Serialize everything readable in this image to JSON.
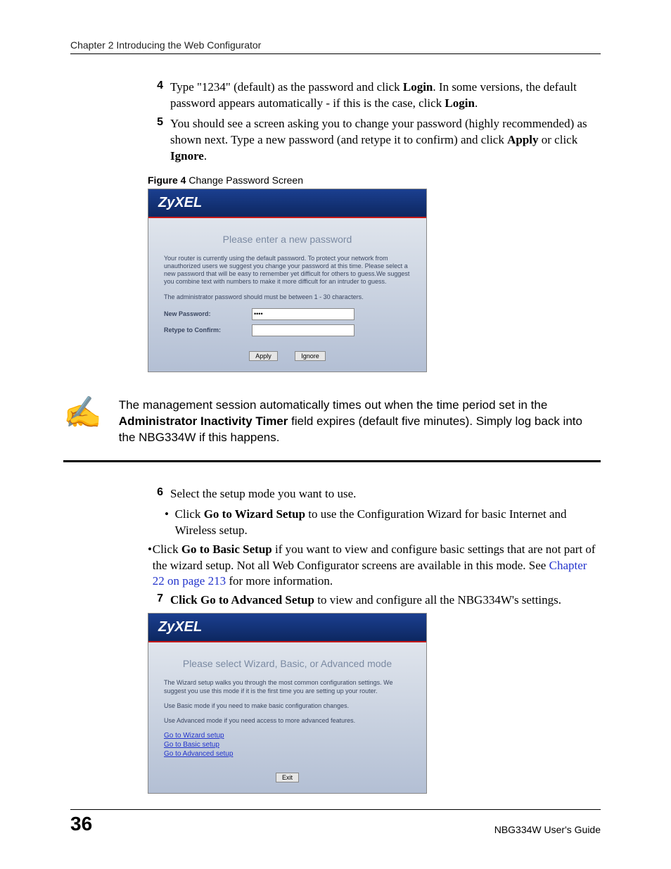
{
  "header": {
    "chapter": "Chapter 2 Introducing the Web Configurator"
  },
  "steps": {
    "s4": {
      "num": "4",
      "prefix": "Type \"1234\" (default) as the password and click ",
      "b1": "Login",
      "mid": ". In some versions, the default password appears automatically - if this is the case, click ",
      "b2": "Login",
      "suffix": "."
    },
    "s5": {
      "num": "5",
      "prefix": "You should see a screen asking you to change your password (highly recommended) as shown next. Type a new password (and retype it to confirm) and click ",
      "b1": "Apply",
      "mid": " or click ",
      "b2": "Ignore",
      "suffix": "."
    },
    "s6": {
      "num": "6",
      "text": "Select the setup mode you want to use."
    },
    "s6a": {
      "prefix": "Click ",
      "b": "Go to Wizard Setup",
      "suffix": " to use the Configuration Wizard for basic Internet and Wireless setup."
    },
    "s6b": {
      "prefix": "Click ",
      "b": "Go to Basic Setup",
      "mid": " if you want to view and configure basic settings that are not part of the wizard setup. Not all Web Configurator screens are available in this mode. See ",
      "link": "Chapter 22 on page 213",
      "suffix": " for more information."
    },
    "s7": {
      "num": "7",
      "b": "Click Go to Advanced Setup",
      "suffix": " to view and configure all the NBG334W's settings."
    }
  },
  "figure4": {
    "caption_b": "Figure 4",
    "caption": "   Change Password Screen",
    "brand": "ZyXEL",
    "title": "Please enter a new password",
    "p1": "Your router is currently using the default password. To protect your network from unauthorized users we suggest you change your password at this time. Please select a new password that will be easy to remember yet difficult for others to guess.We suggest you combine text with numbers to make it more difficult for an intruder to guess.",
    "p2": "The administrator password should must be between 1 - 30 characters.",
    "lbl_new": "New Password:",
    "val_new": "••••",
    "lbl_retype": "Retype to Confirm:",
    "val_retype": "",
    "btn_apply": "Apply",
    "btn_ignore": "Ignore"
  },
  "note": {
    "icon": "✍",
    "t1": "The management session automatically times out when the time period set in the ",
    "b": "Administrator Inactivity Timer",
    "t2": " field expires (default five minutes). Simply log back into the NBG334W if this happens."
  },
  "figure5": {
    "brand": "ZyXEL",
    "title": "Please select Wizard, Basic, or Advanced mode",
    "p1": "The Wizard setup walks you through the most common configuration settings. We suggest you use this mode if it is the first time you are setting up your router.",
    "p2": "Use Basic mode if you need to make basic configuration changes.",
    "p3": "Use Advanced mode if you need access to more advanced features.",
    "link1": "Go to Wizard setup",
    "link2": "Go to Basic setup",
    "link3": "Go to Advanced setup",
    "btn_exit": "Exit"
  },
  "footer": {
    "page": "36",
    "guide": "NBG334W User's Guide"
  }
}
